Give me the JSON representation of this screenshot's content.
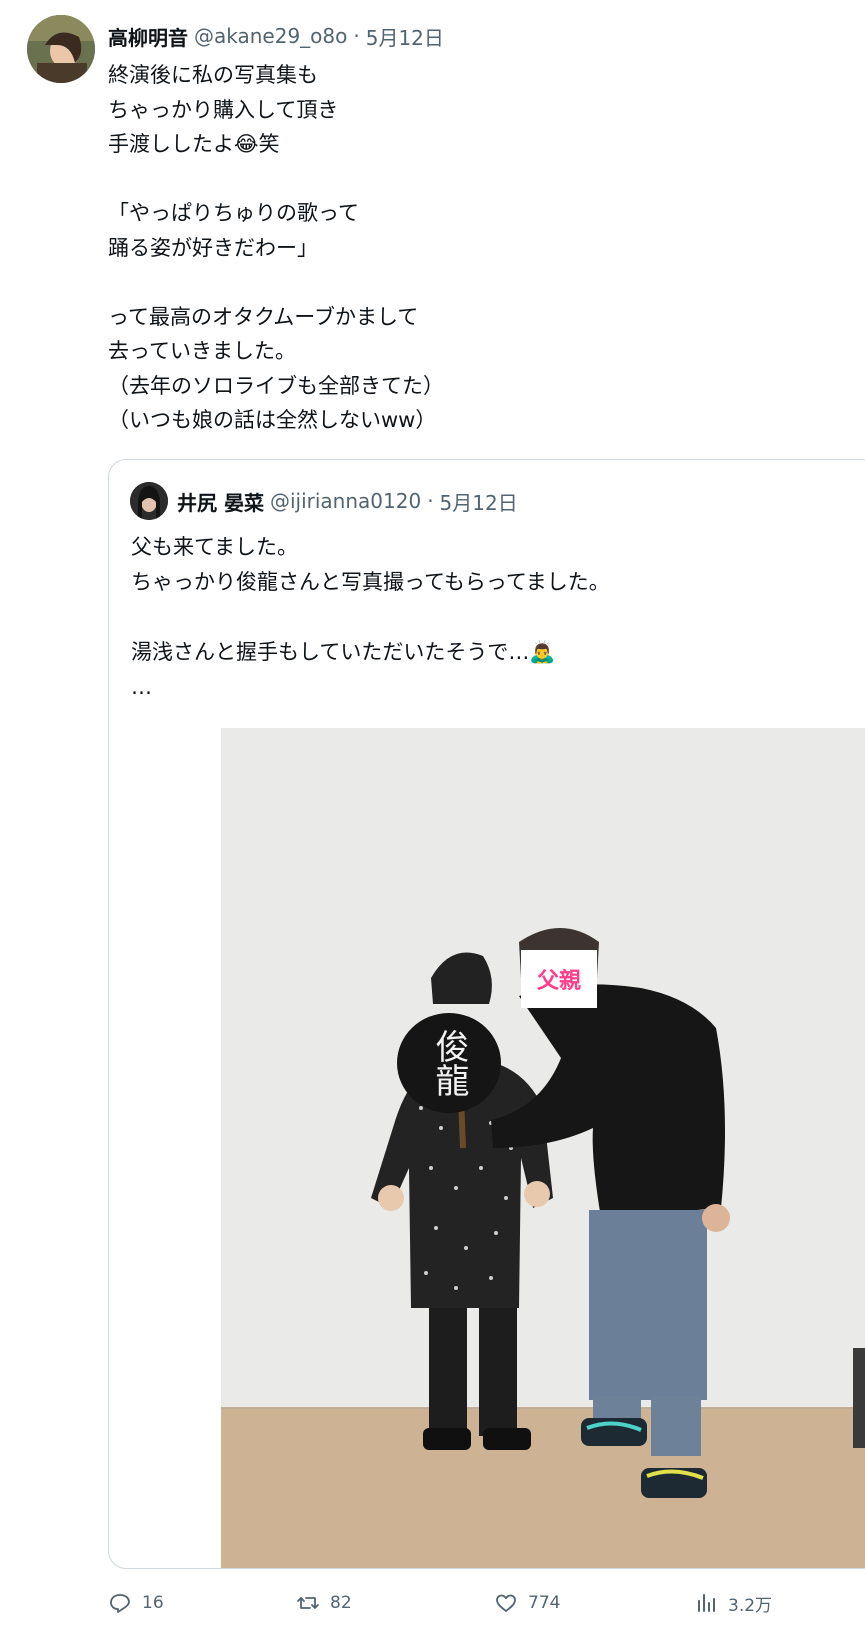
{
  "tweet": {
    "author_name": "高柳明音",
    "handle": "@akane29_o8o",
    "separator": "·",
    "date": "5月12日",
    "text": "終演後に私の写真集も\nちゃっかり購入して頂き\n手渡ししたよ😂笑\n\n「やっぱりちゅりの歌って\n踊る姿が好きだわー」\n\nって最高のオタクムーブかまして\n去っていきました。\n（去年のソロライブも全部きてた）\n（いつも娘の話は全然しないww）"
  },
  "quoted": {
    "author_name": "井尻 晏菜",
    "handle": "@ijirianna0120",
    "separator": "·",
    "date": "5月12日",
    "text": "父も来てました。\nちゃっかり俊龍さんと写真撮ってもらってました。\n\n湯浅さんと握手もしていただいたそうで…🙇‍♂️\n…",
    "photo": {
      "fan_text": "俊龍",
      "face_label": "父親"
    }
  },
  "actions": {
    "reply": {
      "icon": "reply-icon",
      "count": "16"
    },
    "retweet": {
      "icon": "retweet-icon",
      "count": "82"
    },
    "like": {
      "icon": "heart-icon",
      "count": "774"
    },
    "views": {
      "icon": "views-icon",
      "count": "3.2万"
    }
  },
  "colors": {
    "text": "#0f1419",
    "muted": "#536471",
    "border": "#cfd9de",
    "face_label": "#ff3d8a"
  }
}
